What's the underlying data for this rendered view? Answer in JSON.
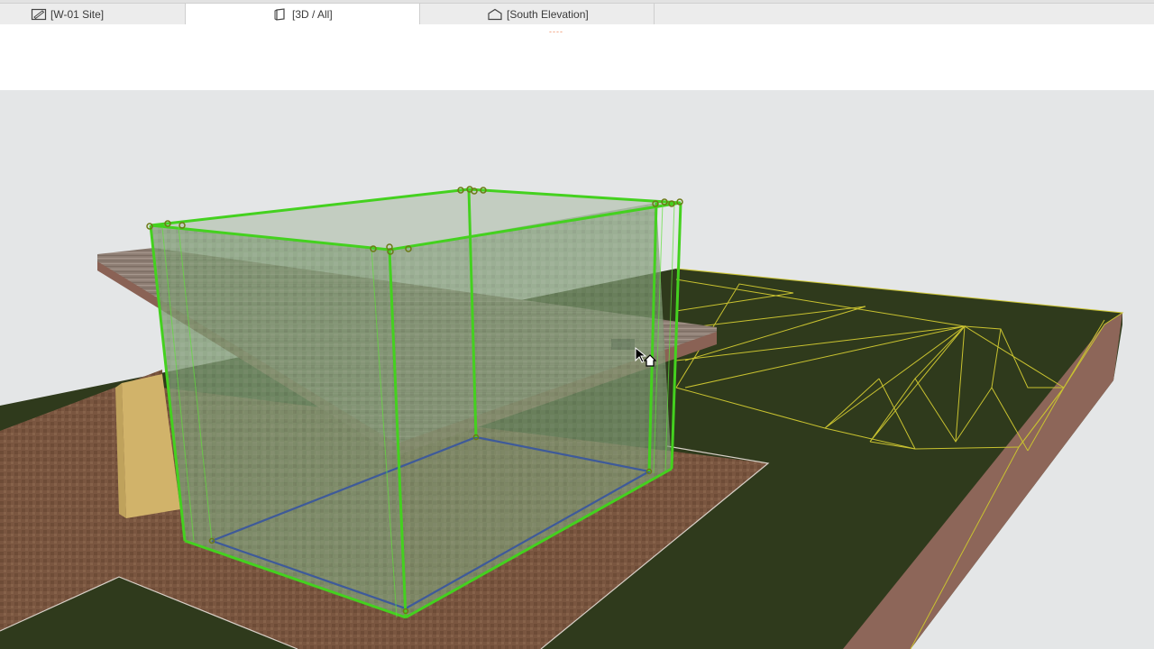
{
  "tabs": [
    {
      "label": "[W-01 Site]",
      "icon": "site-plan-icon",
      "active": false
    },
    {
      "label": "[3D / All]",
      "icon": "3d-view-icon",
      "active": true
    },
    {
      "label": "[South Elevation]",
      "icon": "elevation-icon",
      "active": false
    }
  ],
  "indicator": "----",
  "colors": {
    "viewport_bg": "#e4e6e7",
    "selection": "#44d11f",
    "terrain": "#2f3a1c",
    "mesh_lines": "#c9c230",
    "paving": "#7a5640",
    "floor_outline": "#3e5a9a"
  }
}
